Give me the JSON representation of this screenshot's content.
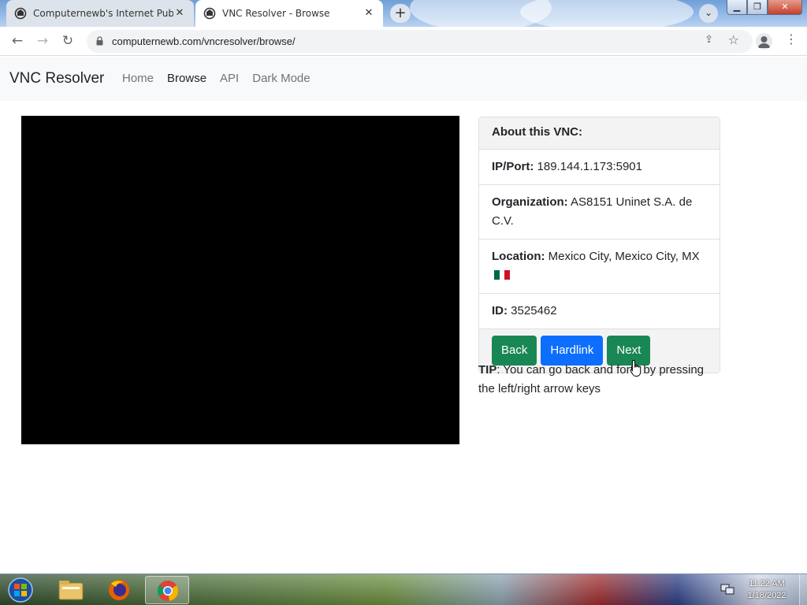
{
  "browser": {
    "tabs": [
      {
        "title": "Computernewb's Internet Pub Hu",
        "active": false
      },
      {
        "title": "VNC Resolver - Browse",
        "active": true
      }
    ],
    "url": "computernewb.com/vncresolver/browse/"
  },
  "navbar": {
    "brand": "VNC Resolver",
    "links": [
      {
        "label": "Home",
        "active": false
      },
      {
        "label": "Browse",
        "active": true
      },
      {
        "label": "API",
        "active": false
      },
      {
        "label": "Dark Mode",
        "active": false
      }
    ]
  },
  "card": {
    "header": "About this VNC:",
    "ip_label": "IP/Port:",
    "ip_value": "189.144.1.173:5901",
    "org_label": "Organization:",
    "org_value": "AS8151 Uninet S.A. de C.V.",
    "loc_label": "Location:",
    "loc_value": "Mexico City, Mexico City, MX",
    "id_label": "ID:",
    "id_value": "3525462",
    "buttons": {
      "back": "Back",
      "hardlink": "Hardlink",
      "next": "Next"
    }
  },
  "tip": {
    "label": "TIP",
    "text": ": You can go back and forth by pressing the left/right arrow keys"
  },
  "taskbar": {
    "time": "11:22 AM",
    "date": "1/18/2022"
  },
  "colors": {
    "success": "#198754",
    "primary": "#0d6efd",
    "navbar_bg": "#f8f9fa"
  }
}
